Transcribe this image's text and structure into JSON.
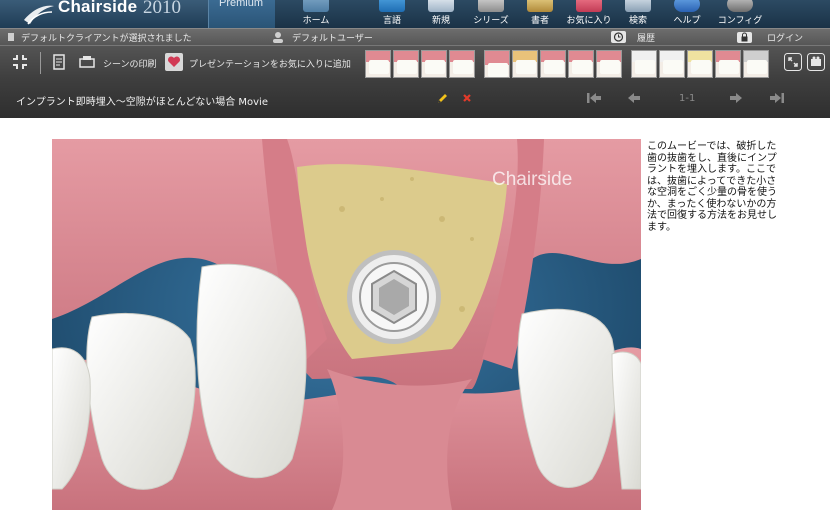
{
  "header": {
    "logo_text": "Chairside",
    "logo_year": "2010",
    "edition": "Premium",
    "nav": [
      {
        "label": "ホーム",
        "icon": "home-icon"
      },
      {
        "label": "言語",
        "icon": "language-icon"
      },
      {
        "label": "新規",
        "icon": "new-icon"
      },
      {
        "label": "シリーズ",
        "icon": "series-icon"
      },
      {
        "label": "書者",
        "icon": "author-icon"
      },
      {
        "label": "お気に入り",
        "icon": "favorites-icon"
      },
      {
        "label": "検索",
        "icon": "search-icon"
      },
      {
        "label": "ヘルプ",
        "icon": "help-icon"
      },
      {
        "label": "コンフィグ",
        "icon": "config-icon"
      }
    ]
  },
  "statusbar": {
    "client": "デフォルトクライアントが選択されました",
    "user": "デフォルトユーザー",
    "history": "履歴",
    "login": "ログイン"
  },
  "toolbar": {
    "print": "シーンの印刷",
    "add_favorite": "プレゼンテーションをお気に入りに追加",
    "thumbnail_count": 14
  },
  "titlebar": {
    "title": "インプラント即時埋入～空隙がほとんどない場合 Movie",
    "page": "1-1"
  },
  "content": {
    "watermark": "Chairside",
    "description": "このムービーでは、破折した歯の抜歯をし、直後にインプラントを埋入します。ここでは、抜歯によってできた小さな空洞をごく少量の骨を使うか、まったく使わないかの方法で回復する方法をお見せします。"
  },
  "colors": {
    "header_bg": "#1f3c55",
    "gum": "#d98a93",
    "bone": "#d9c98c",
    "teeth": "#f4f4ee",
    "background_blue": "#1f4e73"
  }
}
